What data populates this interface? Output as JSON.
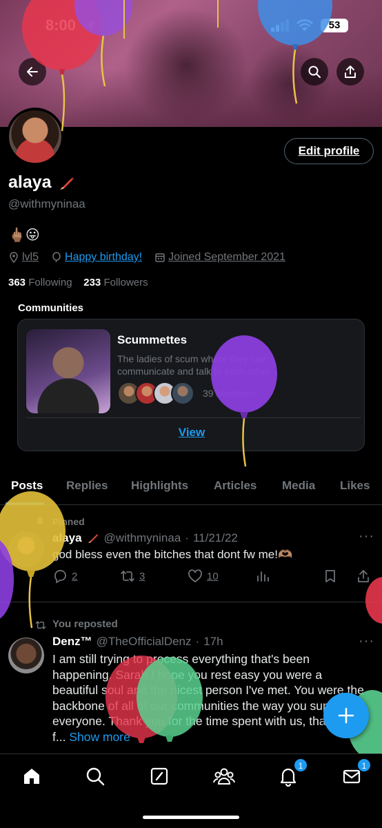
{
  "status_bar": {
    "time": "8:00",
    "battery": "53"
  },
  "profile": {
    "name": "alaya",
    "handle": "@withmyninaa",
    "bio": "🖕🏽😛",
    "location": "lvl5",
    "birthday_link": "Happy birthday!",
    "joined": "Joined September 2021",
    "following_count": "363",
    "following_label": "Following",
    "followers_count": "233",
    "followers_label": "Followers",
    "edit_button": "Edit profile"
  },
  "communities": {
    "title": "Communities",
    "card": {
      "name": "Scummettes",
      "description": "The ladies of scum where they can communicate and talk to each other",
      "members": "39 Members",
      "view_label": "View"
    }
  },
  "tabs": [
    "Posts",
    "Replies",
    "Highlights",
    "Articles",
    "Media",
    "Likes"
  ],
  "posts": [
    {
      "label": "Pinned",
      "name": "alaya",
      "handle": "@withmyninaa",
      "date": "11/21/22",
      "text": "god bless even the bitches that dont fw me!🫶🏽",
      "replies": "2",
      "reposts": "3",
      "likes": "10"
    },
    {
      "label": "You reposted",
      "name": "Denz™",
      "handle": "@TheOfficialDenz",
      "date": "17h",
      "text": "I am still trying to process everything that's been happening. Sarah I hope you rest easy you were a beautiful soul and the nicest person I've met. You were the backbone of all of our communities the way you supported everyone. Thank you for the time spent with us, thank you f...",
      "show_more": "Show more"
    }
  ],
  "nav": {
    "notifications_badge": "1",
    "messages_badge": "1"
  },
  "colors": {
    "accent": "#1d9bf0",
    "background": "#000000",
    "muted": "#71767b"
  }
}
